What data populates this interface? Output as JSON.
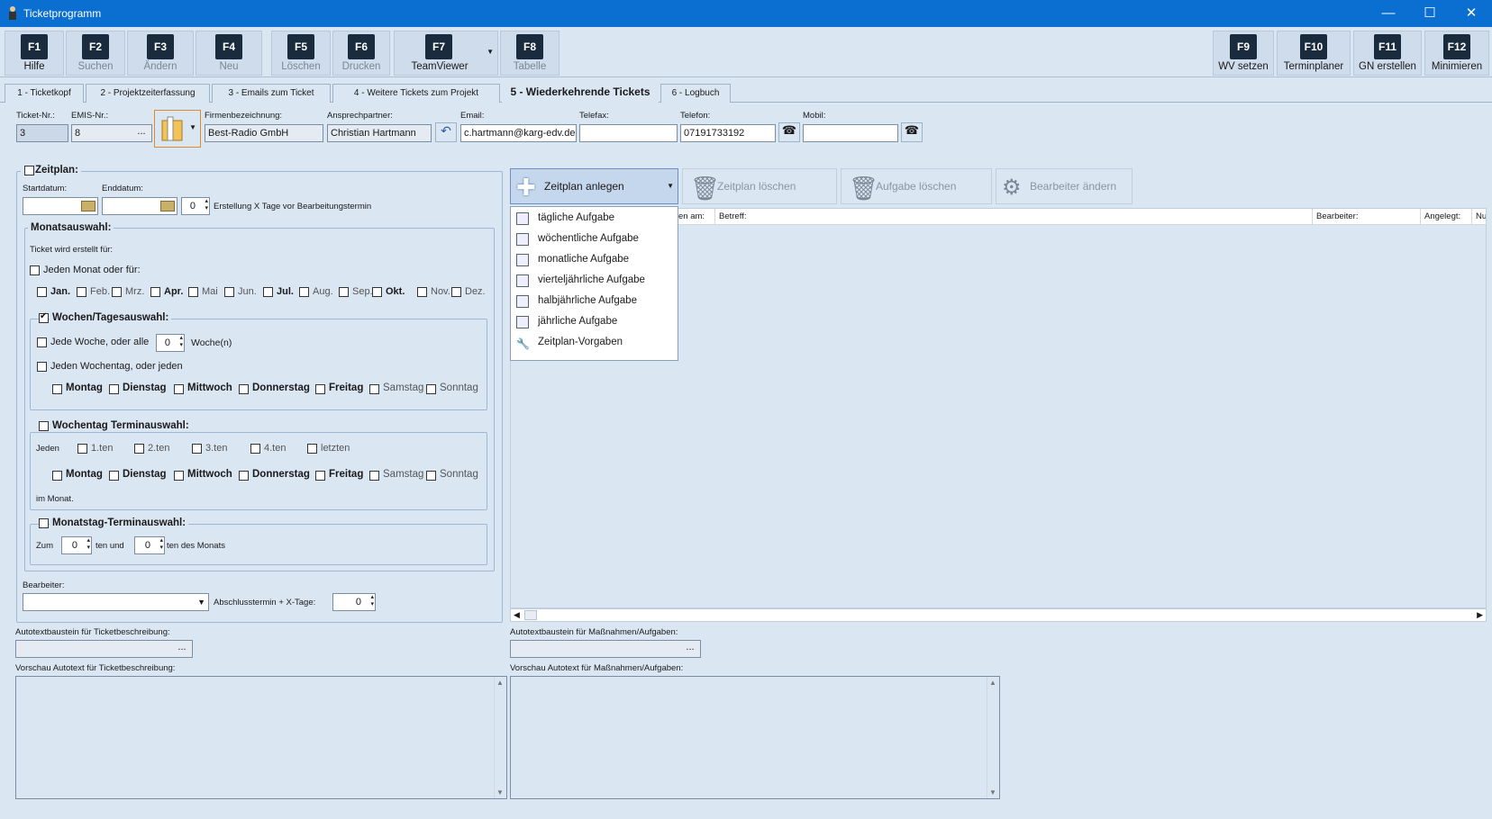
{
  "window": {
    "title": "Ticketprogramm",
    "minimize_glyph": "—",
    "maximize_glyph": "☐",
    "close_glyph": "✕"
  },
  "toolbar": {
    "left": [
      {
        "key": "F1",
        "label": "Hilfe",
        "enabled": true
      },
      {
        "key": "F2",
        "label": "Suchen",
        "enabled": false
      },
      {
        "key": "F3",
        "label": "Ändern",
        "enabled": false
      },
      {
        "key": "F4",
        "label": "Neu",
        "enabled": false
      },
      {
        "key": "F5",
        "label": "Löschen",
        "enabled": false
      },
      {
        "key": "F6",
        "label": "Drucken",
        "enabled": false
      },
      {
        "key": "F7",
        "label": "TeamViewer",
        "enabled": true
      },
      {
        "key": "F8",
        "label": "Tabelle",
        "enabled": false
      }
    ],
    "right": [
      {
        "key": "F9",
        "label": "WV setzen"
      },
      {
        "key": "F10",
        "label": "Terminplaner"
      },
      {
        "key": "F11",
        "label": "GN erstellen"
      },
      {
        "key": "F12",
        "label": "Minimieren"
      }
    ]
  },
  "tabs": [
    {
      "label": "1 - Ticketkopf"
    },
    {
      "label": "2 - Projektzeiterfassung"
    },
    {
      "label": "3 - Emails zum Ticket"
    },
    {
      "label": "4 - Weitere Tickets zum Projekt"
    },
    {
      "label": "5 - Wiederkehrende Tickets",
      "active": true
    },
    {
      "label": "6 - Logbuch"
    }
  ],
  "header": {
    "ticket_nr_label": "Ticket-Nr.:",
    "ticket_nr": "3",
    "emis_label": "EMIS-Nr.:",
    "emis": "8",
    "ellipsis": "...",
    "firma_label": "Firmenbezeichnung:",
    "firma": "Best-Radio GmbH",
    "ansprech_label": "Ansprechpartner:",
    "ansprech": "Christian Hartmann",
    "email_label": "Email:",
    "email": "c.hartmann@karg-edv.de",
    "telefax_label": "Telefax:",
    "telefax": "",
    "telefon_label": "Telefon:",
    "telefon": "07191733192",
    "mobil_label": "Mobil:",
    "mobil": ""
  },
  "zeitplan": {
    "title": "Zeitplan:",
    "start_label": "Startdatum:",
    "end_label": "Enddatum:",
    "days_value": "0",
    "days_label": "Erstellung X Tage vor Bearbeitungstermin",
    "monats": {
      "title": "Monatsauswahl:",
      "subtitle": "Ticket wird erstellt für:",
      "jeden_monat": "Jeden Monat oder für:",
      "months": [
        "Jan.",
        "Feb.",
        "Mrz.",
        "Apr.",
        "Mai",
        "Jun.",
        "Jul.",
        "Aug.",
        "Sep.",
        "Okt.",
        "Nov.",
        "Dez."
      ]
    },
    "wochen": {
      "title": "Wochen/Tagesauswahl:",
      "jede_woche": "Jede Woche, oder alle",
      "woche_val": "0",
      "woche_unit": "Woche(n)",
      "jeden_wochentag": "Jeden Wochentag, oder jeden",
      "days": [
        "Montag",
        "Dienstag",
        "Mittwoch",
        "Donnerstag",
        "Freitag",
        "Samstag",
        "Sonntag"
      ]
    },
    "wochentag_termin": {
      "title": "Wochentag Terminauswahl:",
      "jeden": "Jeden",
      "ordinals": [
        "1.ten",
        "2.ten",
        "3.ten",
        "4.ten",
        "letzten"
      ],
      "days": [
        "Montag",
        "Dienstag",
        "Mittwoch",
        "Donnerstag",
        "Freitag",
        "Samstag",
        "Sonntag"
      ],
      "im_monat": "im Monat."
    },
    "monatstag": {
      "title": "Monatstag-Terminauswahl:",
      "zum": "Zum",
      "val1": "0",
      "ten_und": "ten und",
      "val2": "0",
      "ten_des": "ten des Monats"
    },
    "bearbeiter_label": "Bearbeiter:",
    "abschluss_label": "Abschlusstermin + X-Tage:",
    "abschluss_val": "0"
  },
  "actions": {
    "anlegen": "Zeitplan anlegen",
    "loeschen": "Zeitplan löschen",
    "aufgabe_loeschen": "Aufgabe löschen",
    "bearbeiter_aendern": "Bearbeiter ändern"
  },
  "menu": [
    "tägliche Aufgabe",
    "wöchentliche Aufgabe",
    "monatliche Aufgabe",
    "vierteljährliche Aufgabe",
    "halbjährliche Aufgabe",
    "jährliche Aufgabe",
    "Zeitplan-Vorgaben"
  ],
  "grid": {
    "columns": [
      "en am:",
      "Betreff:",
      "Bearbeiter:",
      "Angelegt:",
      "Nu"
    ]
  },
  "bottom": {
    "autotext_ticket_label": "Autotextbaustein für Ticketbeschreibung:",
    "autotext_massn_label": "Autotextbaustein für Maßnahmen/Aufgaben:",
    "vorschau_ticket_label": "Vorschau Autotext für Ticketbeschreibung:",
    "vorschau_massn_label": "Vorschau Autotext für Maßnahmen/Aufgaben:"
  }
}
